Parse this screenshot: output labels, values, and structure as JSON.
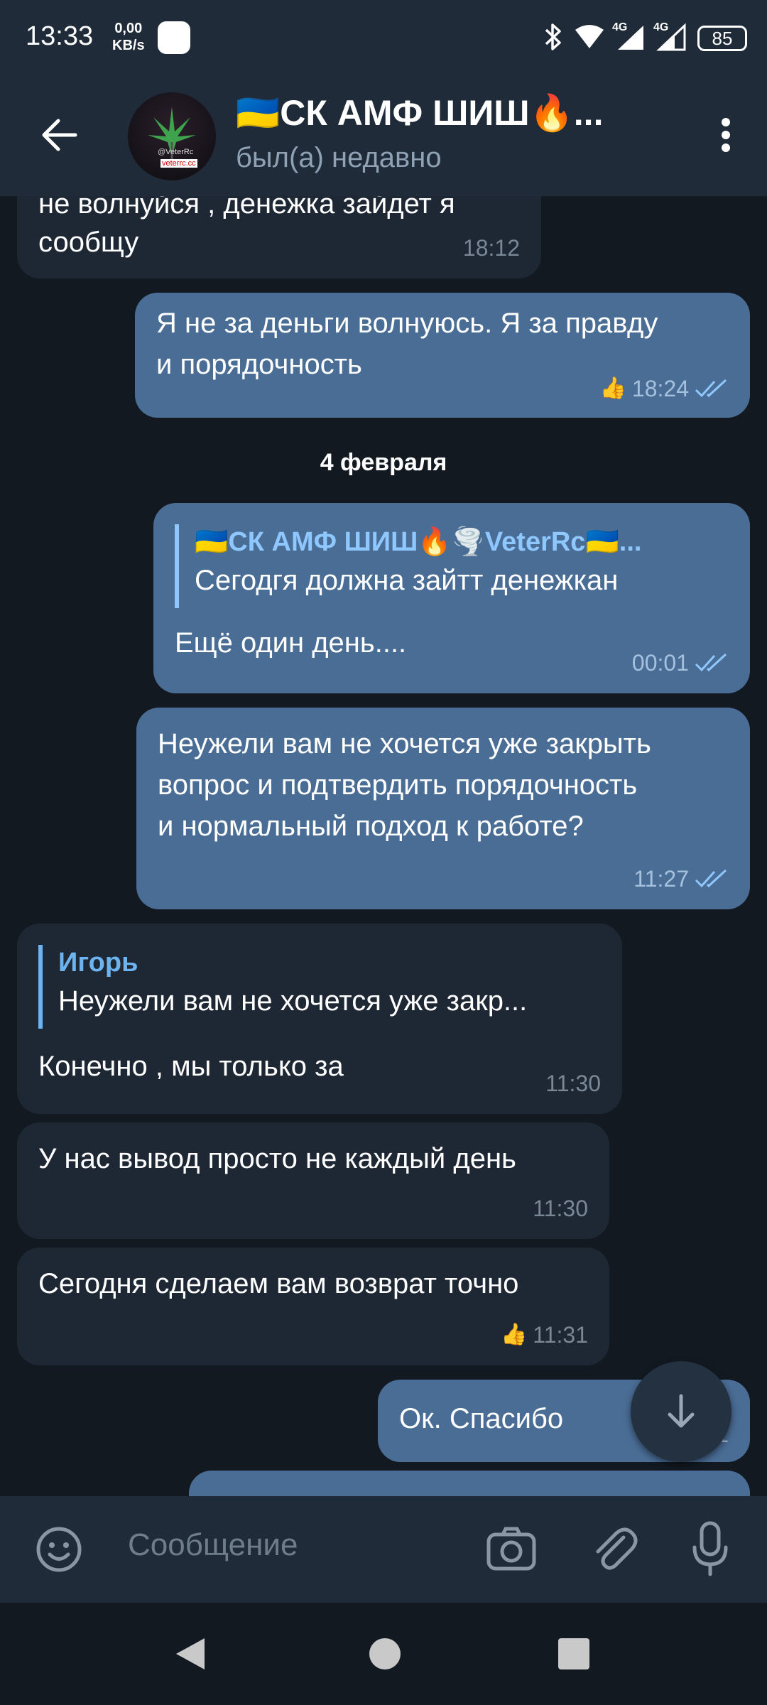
{
  "status_bar": {
    "time": "13:33",
    "net_speed_value": "0,00",
    "net_speed_unit": "KB/s",
    "signal_1": "4G",
    "signal_2": "4G",
    "battery": "85"
  },
  "header": {
    "title": "🇺🇦СК АМФ ШИШ🔥...",
    "status": "был(а) недавно",
    "avatar_text_1": "@VeterRc",
    "avatar_text_2": "veterrc.cc"
  },
  "date_separator": "4 февраля",
  "messages": [
    {
      "id": "m1",
      "direction": "in",
      "text_partial": "не волнуйся , денежка зайдет я",
      "text": "сообщу",
      "time": "18:12"
    },
    {
      "id": "m2",
      "direction": "out",
      "line1": "Я не за деньги волнуюсь. Я за правду",
      "line2": "и порядочность",
      "time": "18:24",
      "reaction": "👍",
      "read": true
    },
    {
      "id": "m3",
      "direction": "out",
      "quote_name": "🇺🇦СК АМФ ШИШ🔥🌪️VeterRc🇺🇦...",
      "quote_text": "Сегодгя должна зайтт денежкан",
      "text": "Ещё один день....",
      "time": "00:01",
      "read": true
    },
    {
      "id": "m4",
      "direction": "out",
      "line1": "Неужели вам не хочется уже закрыть",
      "line2": "вопрос и подтвердить порядочность",
      "line3": "и нормальный подход к работе?",
      "time": "11:27",
      "read": true
    },
    {
      "id": "m5",
      "direction": "in",
      "quote_name": "Игорь",
      "quote_text": "Неужели вам не хочется уже закр...",
      "text": "Конечно , мы только за",
      "time": "11:30"
    },
    {
      "id": "m6",
      "direction": "in",
      "text": "У нас вывод просто не каждый день",
      "time": "11:30"
    },
    {
      "id": "m7",
      "direction": "in",
      "text": "Сегодня сделаем вам возврат точно",
      "time": "11:31",
      "reaction": "👍"
    },
    {
      "id": "m8",
      "direction": "out",
      "text": "Ок. Спасибо",
      "time": "1",
      "reaction": "👍"
    }
  ],
  "input": {
    "placeholder": "Сообщение"
  },
  "colors": {
    "background": "#121921",
    "bar": "#1f2b38",
    "incoming_bubble": "#1e2734",
    "outgoing_bubble": "#4a6d96",
    "accent": "#6cb3f0"
  },
  "icons": {
    "back": "arrow-left-icon",
    "menu": "more-vertical-icon",
    "emoji": "emoji-icon",
    "camera": "camera-icon",
    "attach": "paperclip-icon",
    "mic": "microphone-icon",
    "scroll_down": "arrow-down-icon"
  }
}
